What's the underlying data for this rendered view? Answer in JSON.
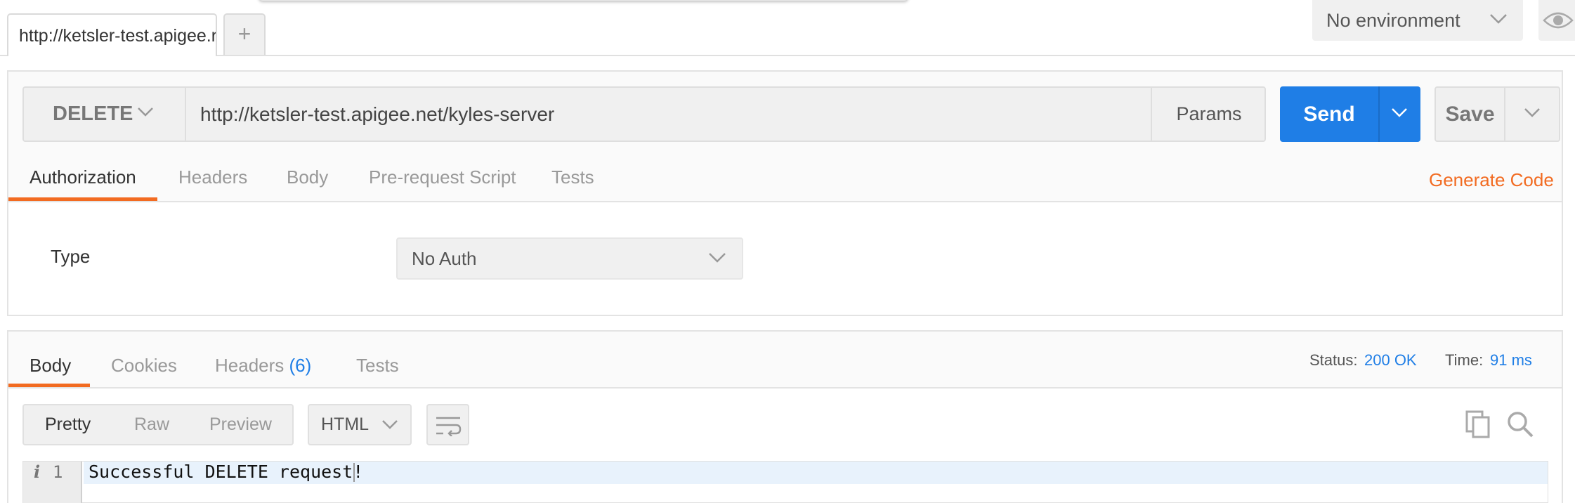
{
  "tabs": {
    "request_tab_title": "http://ketsler-test.apigee.r",
    "new_tab_symbol": "+"
  },
  "environment": {
    "selected": "No environment"
  },
  "request": {
    "method": "DELETE",
    "url": "http://ketsler-test.apigee.net/kyles-server",
    "params_label": "Params",
    "send_label": "Send",
    "save_label": "Save"
  },
  "request_tabs": [
    {
      "label": "Authorization",
      "active": true
    },
    {
      "label": "Headers",
      "active": false
    },
    {
      "label": "Body",
      "active": false
    },
    {
      "label": "Pre-request Script",
      "active": false
    },
    {
      "label": "Tests",
      "active": false
    }
  ],
  "generate_code_label": "Generate Code",
  "authorization": {
    "type_label": "Type",
    "type_value": "No Auth"
  },
  "response": {
    "tabs": [
      {
        "label": "Body",
        "active": true
      },
      {
        "label": "Cookies",
        "active": false
      },
      {
        "label": "Headers",
        "count": "(6)",
        "active": false
      },
      {
        "label": "Tests",
        "active": false
      }
    ],
    "status_label": "Status:",
    "status_value": "200 OK",
    "time_label": "Time:",
    "time_value": "91 ms",
    "view_modes": [
      "Pretty",
      "Raw",
      "Preview"
    ],
    "active_view": "Pretty",
    "format": "HTML",
    "line_number": "1",
    "info_marker": "i",
    "body_text": "Successful DELETE request!"
  },
  "colors": {
    "accent_orange": "#f26b21",
    "send_blue": "#1f7ee6",
    "status_blue": "#1f7ee6"
  },
  "icons": [
    "chevron-down-icon",
    "eye-icon",
    "wrap-lines-icon",
    "copy-icon",
    "search-icon"
  ]
}
